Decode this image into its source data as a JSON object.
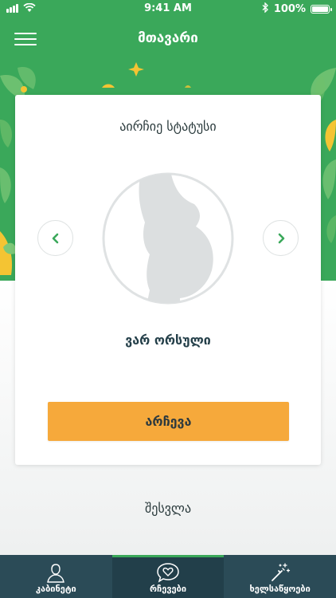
{
  "status_bar": {
    "time": "9:41 AM",
    "battery": "100%"
  },
  "header": {
    "title": "მთავარი"
  },
  "card": {
    "heading": "აირჩიე სტატუსი",
    "status_label": "ვარ ორსული",
    "choose_button": "არჩევა"
  },
  "login_link": "შესვლა",
  "tabs": [
    {
      "label": "კაბინეტი",
      "icon": "person-icon",
      "active": false
    },
    {
      "label": "რჩევები",
      "icon": "heart-chat-icon",
      "active": true
    },
    {
      "label": "ხელსაწყოები",
      "icon": "magic-wand-icon",
      "active": false
    }
  ],
  "colors": {
    "brand_green": "#3aa85a",
    "accent_orange": "#f6a93b",
    "tab_bar": "#2b4b57",
    "leaf_light": "#7dc878",
    "flower_yellow": "#f4c433"
  }
}
